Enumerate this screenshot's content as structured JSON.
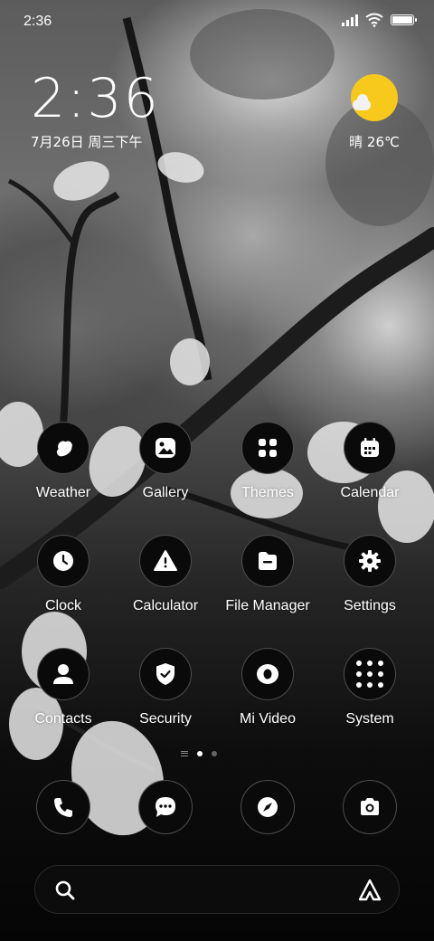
{
  "status_bar": {
    "time": "2:36"
  },
  "clock_widget": {
    "time": "2:36",
    "date": "7月26日 周三下午"
  },
  "weather_widget": {
    "condition_icon": "sun-cloud-icon",
    "text": "晴 26℃"
  },
  "apps": [
    {
      "id": "weather",
      "label": "Weather",
      "icon": "weather-icon"
    },
    {
      "id": "gallery",
      "label": "Gallery",
      "icon": "gallery-icon"
    },
    {
      "id": "themes",
      "label": "Themes",
      "icon": "themes-icon"
    },
    {
      "id": "calendar",
      "label": "Calendar",
      "icon": "calendar-icon"
    },
    {
      "id": "clock",
      "label": "Clock",
      "icon": "clock-icon"
    },
    {
      "id": "calculator",
      "label": "Calculator",
      "icon": "calculator-icon"
    },
    {
      "id": "file-manager",
      "label": "File Manager",
      "icon": "file-manager-icon"
    },
    {
      "id": "settings",
      "label": "Settings",
      "icon": "gear-icon"
    },
    {
      "id": "contacts",
      "label": "Contacts",
      "icon": "contacts-icon"
    },
    {
      "id": "security",
      "label": "Security",
      "icon": "shield-icon"
    },
    {
      "id": "mi-video",
      "label": "Mi Video",
      "icon": "video-icon"
    },
    {
      "id": "system",
      "label": "System",
      "icon": "folder-icon"
    }
  ],
  "pager": {
    "pages": 2,
    "active_page": 1
  },
  "dock": [
    {
      "id": "phone",
      "icon": "phone-icon"
    },
    {
      "id": "messages",
      "icon": "message-icon"
    },
    {
      "id": "browser",
      "icon": "compass-icon"
    },
    {
      "id": "camera",
      "icon": "camera-icon"
    }
  ],
  "colors": {
    "sun": "#f7c91c",
    "icon_bg": "#0a0a0a"
  }
}
